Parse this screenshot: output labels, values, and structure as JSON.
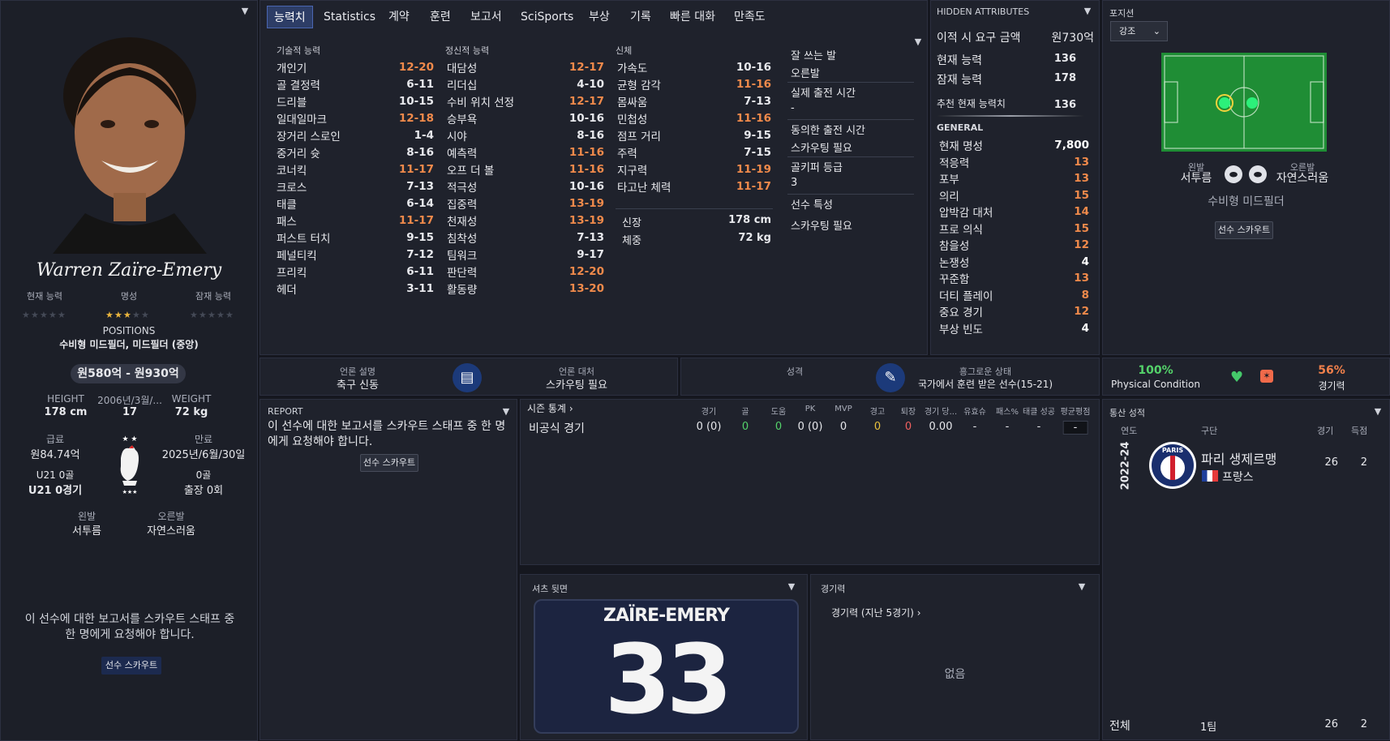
{
  "player": {
    "name": "Warren Zaïre-Emery",
    "stat_labels": [
      "현재 능력",
      "명성",
      "잠재 능력"
    ],
    "positions_title": "POSITIONS",
    "positions": "수비형 미드필더, 미드필더 (중앙)",
    "value": "원580억 - 원930억",
    "height_label": "HEIGHT",
    "height": "178 cm",
    "dob": "2006년/3월/...",
    "age": "17",
    "weight_label": "WEIGHT",
    "weight": "72 kg",
    "wage_label": "급료",
    "wage": "원84.74억",
    "expiry_label": "만료",
    "expiry": "2025년/6월/30일",
    "u21_goals": "U21 0골",
    "u21_apps": "U21 0경기",
    "goals": "0골",
    "apps": "출장 0회",
    "left_foot_label": "왼발",
    "left_foot": "서투름",
    "right_foot_label": "오른발",
    "right_foot": "자연스러움",
    "report_msg": "이 선수에 대한 보고서를 스카우트 스태프 중 한 명에게 요청해야 합니다.",
    "scout_btn": "선수 스카우트"
  },
  "tabs": [
    "능력치",
    "Statistics",
    "계약",
    "훈련",
    "보고서",
    "SciSports",
    "부상",
    "기록",
    "빠른 대화",
    "만족도"
  ],
  "attributes": {
    "technical_title": "기술적 능력",
    "technical": [
      {
        "n": "개인기",
        "v": "12-20",
        "hi": true
      },
      {
        "n": "골 결정력",
        "v": "6-11",
        "hi": false
      },
      {
        "n": "드리블",
        "v": "10-15",
        "hi": false
      },
      {
        "n": "일대일마크",
        "v": "12-18",
        "hi": true
      },
      {
        "n": "장거리 스로인",
        "v": "1-4",
        "hi": false
      },
      {
        "n": "중거리 슛",
        "v": "8-16",
        "hi": false
      },
      {
        "n": "코너킥",
        "v": "11-17",
        "hi": true
      },
      {
        "n": "크로스",
        "v": "7-13",
        "hi": false
      },
      {
        "n": "태클",
        "v": "6-14",
        "hi": false
      },
      {
        "n": "패스",
        "v": "11-17",
        "hi": true
      },
      {
        "n": "퍼스트 터치",
        "v": "9-15",
        "hi": false
      },
      {
        "n": "페널티킥",
        "v": "7-12",
        "hi": false
      },
      {
        "n": "프리킥",
        "v": "6-11",
        "hi": false
      },
      {
        "n": "헤더",
        "v": "3-11",
        "hi": false
      }
    ],
    "mental_title": "정신적 능력",
    "mental": [
      {
        "n": "대담성",
        "v": "12-17",
        "hi": true
      },
      {
        "n": "리더십",
        "v": "4-10",
        "hi": false
      },
      {
        "n": "수비 위치 선정",
        "v": "12-17",
        "hi": true
      },
      {
        "n": "승부욕",
        "v": "10-16",
        "hi": false
      },
      {
        "n": "시야",
        "v": "8-16",
        "hi": false
      },
      {
        "n": "예측력",
        "v": "11-16",
        "hi": true
      },
      {
        "n": "오프 더 볼",
        "v": "11-16",
        "hi": true
      },
      {
        "n": "적극성",
        "v": "10-16",
        "hi": false
      },
      {
        "n": "집중력",
        "v": "13-19",
        "hi": true
      },
      {
        "n": "천재성",
        "v": "13-19",
        "hi": true
      },
      {
        "n": "침착성",
        "v": "7-13",
        "hi": false
      },
      {
        "n": "팀워크",
        "v": "9-17",
        "hi": false
      },
      {
        "n": "판단력",
        "v": "12-20",
        "hi": true
      },
      {
        "n": "활동량",
        "v": "13-20",
        "hi": true
      }
    ],
    "physical_title": "신체",
    "physical": [
      {
        "n": "가속도",
        "v": "10-16",
        "hi": false
      },
      {
        "n": "균형 감각",
        "v": "11-16",
        "hi": true
      },
      {
        "n": "몸싸움",
        "v": "7-13",
        "hi": false
      },
      {
        "n": "민첩성",
        "v": "11-16",
        "hi": true
      },
      {
        "n": "점프 거리",
        "v": "9-15",
        "hi": false
      },
      {
        "n": "주력",
        "v": "7-15",
        "hi": false
      },
      {
        "n": "지구력",
        "v": "11-19",
        "hi": true
      },
      {
        "n": "타고난 체력",
        "v": "11-17",
        "hi": true
      }
    ],
    "height_label": "신장",
    "height": "178 cm",
    "weight_label": "체중",
    "weight": "72 kg",
    "side": [
      {
        "t": "잘 쓰는 발",
        "v": "오른발"
      },
      {
        "t": "실제 출전 시간",
        "v": "-"
      },
      {
        "t": "동의한 출전 시간",
        "v": "스카우팅 필요"
      },
      {
        "t": "골키퍼 등급",
        "v": "3"
      },
      {
        "t": "선수 특성",
        "v": "스카우팅 필요"
      }
    ]
  },
  "hidden": {
    "title": "HIDDEN ATTRIBUTES",
    "transfer_label": "이적 시 요구 금액",
    "transfer": "원730억",
    "ca_label": "현재 능력",
    "ca": "136",
    "pa_label": "잠재 능력",
    "pa": "178",
    "rec_label": "추천 현재 능력치",
    "rec": "136",
    "general_title": "GENERAL",
    "rows": [
      {
        "n": "현재 명성",
        "v": "7,800",
        "c": "#ffffff"
      },
      {
        "n": "적응력",
        "v": "13",
        "c": "#f08a4b"
      },
      {
        "n": "포부",
        "v": "13",
        "c": "#f08a4b"
      },
      {
        "n": "의리",
        "v": "15",
        "c": "#f08a4b"
      },
      {
        "n": "압박감 대처",
        "v": "14",
        "c": "#f08a4b"
      },
      {
        "n": "프로 의식",
        "v": "15",
        "c": "#f08a4b"
      },
      {
        "n": "참을성",
        "v": "12",
        "c": "#f08a4b"
      },
      {
        "n": "논쟁성",
        "v": "4",
        "c": "#ffffff"
      },
      {
        "n": "꾸준함",
        "v": "13",
        "c": "#f08a4b"
      },
      {
        "n": "더티 플레이",
        "v": "8",
        "c": "#f08a4b"
      },
      {
        "n": "중요 경기",
        "v": "12",
        "c": "#f08a4b"
      },
      {
        "n": "부상 빈도",
        "v": "4",
        "c": "#ffffff"
      }
    ]
  },
  "position_panel": {
    "title": "포지션",
    "dropdown": "강조",
    "left_label": "왼발",
    "left": "서투름",
    "right_label": "오른발",
    "right": "자연스러움",
    "role": "수비형 미드필더",
    "scout_btn": "선수 스카우트"
  },
  "media": {
    "desc_label": "언론 설명",
    "desc": "축구 신동",
    "handling_label": "언론 대처",
    "handling": "스카우팅 필요"
  },
  "personality": {
    "label": "성격",
    "status_label": "흥그로운 상태",
    "status": "국가에서 훈련 받은 선수(15-21)"
  },
  "condition": {
    "pct": "100%",
    "label": "Physical Condition",
    "sharp_pct": "56%",
    "sharp_label": "경기력"
  },
  "report": {
    "title": "REPORT",
    "msg": "이 선수에 대한 보고서를 스카우트 스태프 중 한 명에게 요청해야 합니다.",
    "btn": "선수 스카우트"
  },
  "season": {
    "title": "시즌 통계",
    "headers": [
      "경기",
      "골",
      "도움",
      "PK",
      "MVP",
      "경고",
      "퇴장",
      "경기 당...",
      "유효슈",
      "패스%",
      "태클 성공",
      "평균평점"
    ],
    "row_label": "비공식 경기",
    "values": [
      "0 (0)",
      "0",
      "0",
      "0 (0)",
      "0",
      "0",
      "0",
      "0.00",
      "-",
      "-",
      "-",
      "-"
    ]
  },
  "shirt": {
    "title": "셔츠 뒷면",
    "name": "ZAÏRE-EMERY",
    "number": "33"
  },
  "form": {
    "title": "경기력",
    "sub": "경기력 (지난 5경기) ›",
    "empty": "없음"
  },
  "career": {
    "title": "통산 성적",
    "headers": [
      "연도",
      "구단",
      "경기",
      "득점"
    ],
    "year": "2022-24",
    "club": "파리 생제르맹",
    "nation": "프랑스",
    "apps": "26",
    "goals": "2",
    "total_label": "전체",
    "total_team": "1팀",
    "total_apps": "26",
    "total_goals": "2",
    "club_badge": "PARIS"
  }
}
